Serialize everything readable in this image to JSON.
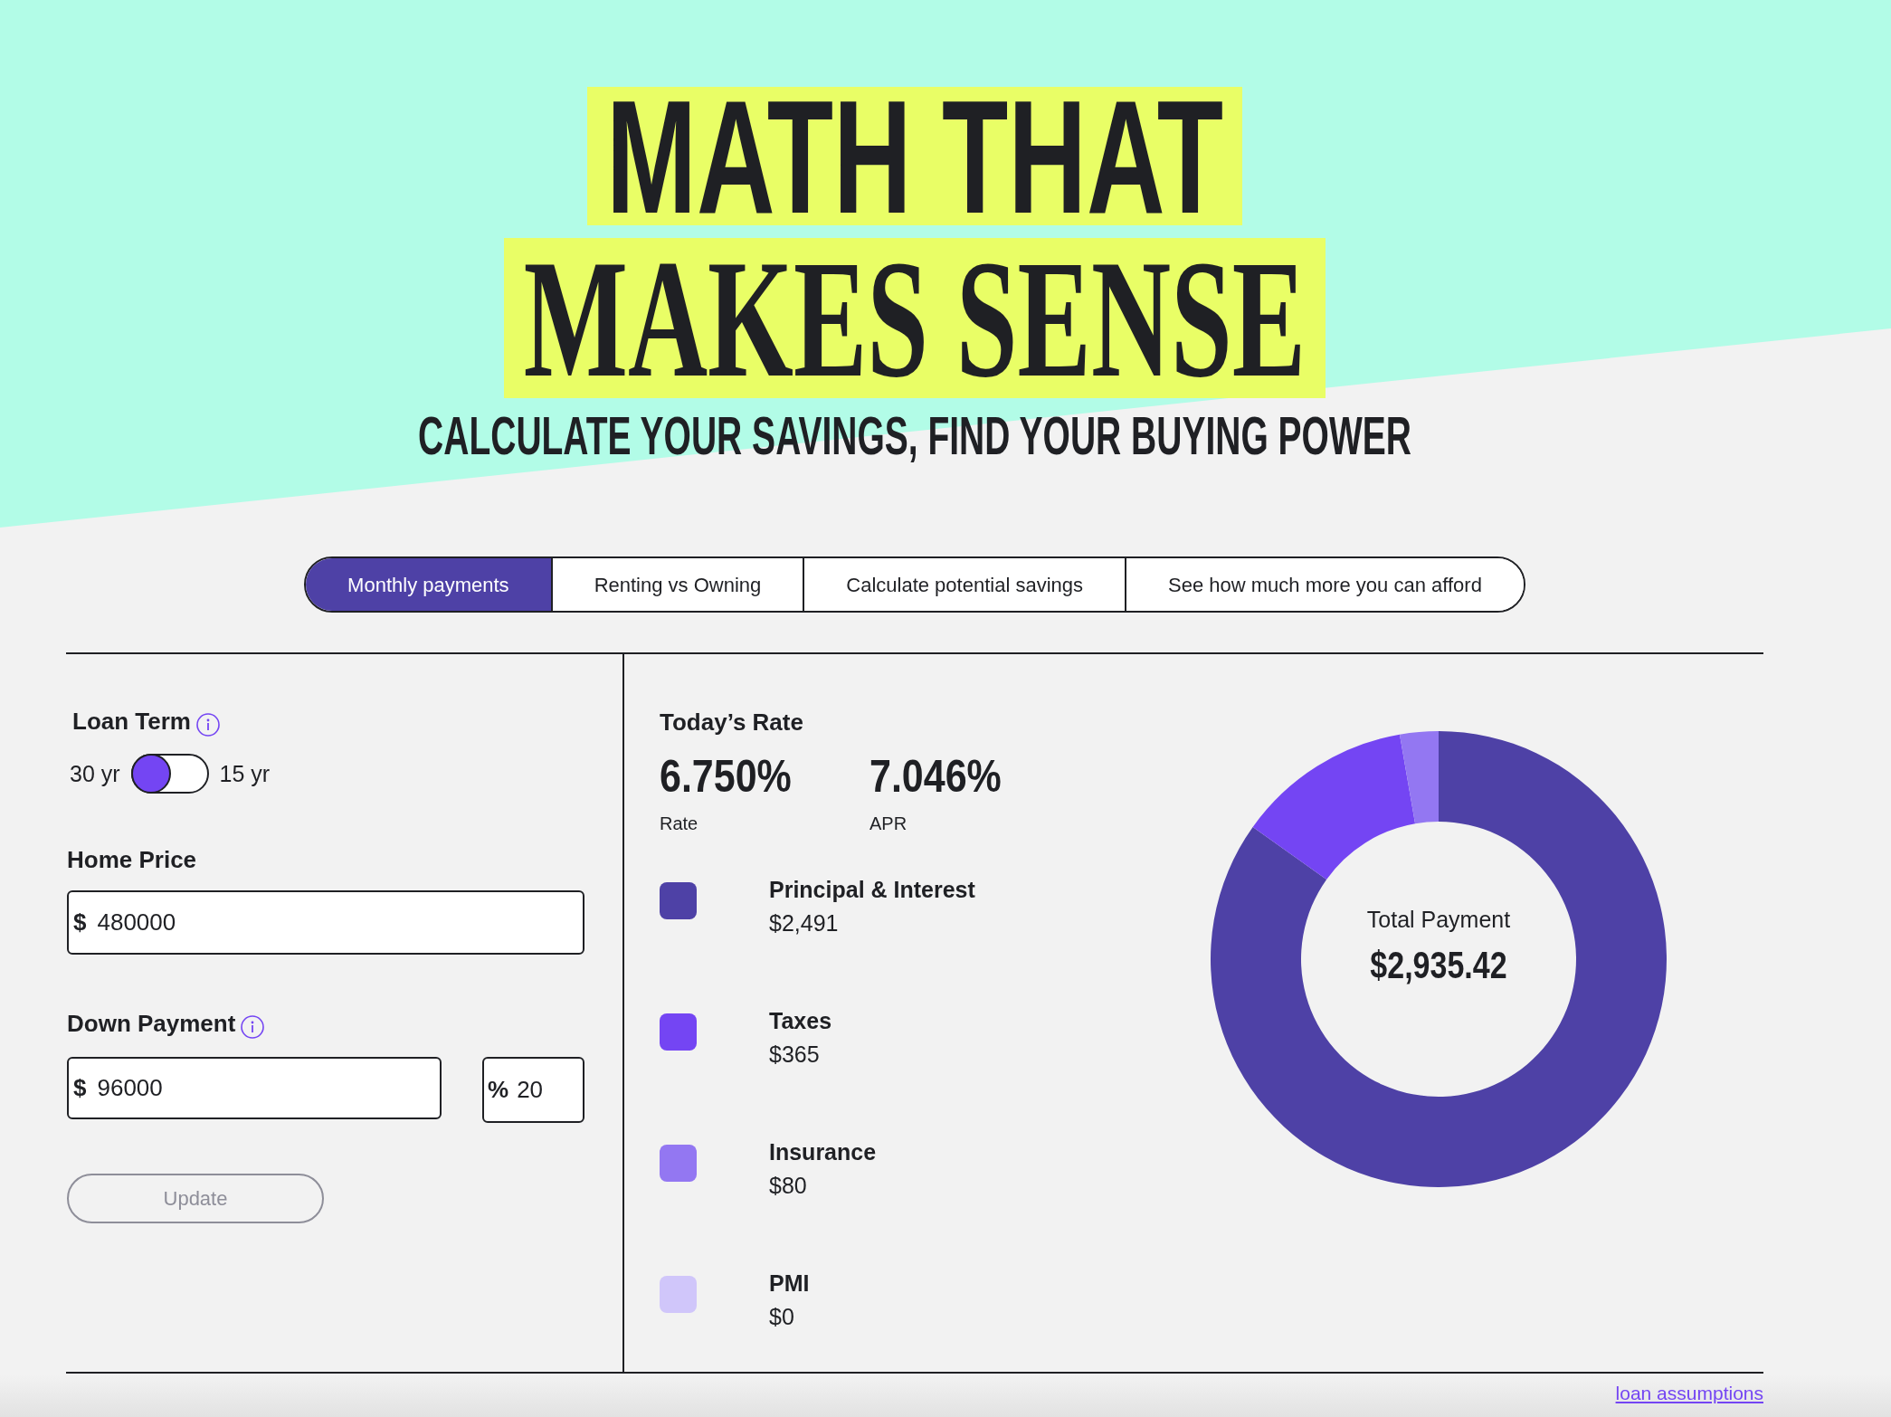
{
  "hero": {
    "headline": [
      {
        "text": "MATH THAT",
        "kind": "sans"
      },
      {
        "text": "MAKES SENSE",
        "kind": "serif"
      }
    ],
    "subheadline": "CALCULATE YOUR SAVINGS, FIND YOUR BUYING POWER"
  },
  "tabs": [
    {
      "label": "Monthly payments",
      "selected": true
    },
    {
      "label": "Renting vs Owning",
      "selected": false
    },
    {
      "label": "Calculate potential savings",
      "selected": false
    },
    {
      "label": "See how much more you can afford",
      "selected": false
    }
  ],
  "form": {
    "loan_term": {
      "label": "Loan Term",
      "options": [
        "30 yr",
        "15 yr"
      ],
      "on": false
    },
    "home_price": {
      "label": "Home Price",
      "prefix": "$",
      "value": "480000"
    },
    "down_payment": {
      "label": "Down Payment",
      "amount": {
        "prefix": "$",
        "value": "96000"
      },
      "percent": {
        "prefix": "%",
        "value": "20"
      }
    },
    "update_button": {
      "label": "Update",
      "disabled": true
    }
  },
  "rates": {
    "title": "Today’s Rate",
    "items": [
      {
        "value": "6.750%",
        "label": "Rate"
      },
      {
        "value": "7.046%",
        "label": "APR"
      }
    ]
  },
  "breakdown": {
    "chart_data": {
      "type": "donut",
      "categories": [
        "Principal & Interest",
        "Taxes",
        "Insurance",
        "PMI"
      ],
      "values": [
        84.84,
        12.43,
        2.73,
        0
      ],
      "colors": [
        "#4e41a6",
        "#7445f3",
        "#9377f2",
        "#d0c6fa"
      ]
    },
    "legend_amounts": [
      "$2,491",
      "$365",
      "$80",
      "$0"
    ],
    "center_label": "Total Payment",
    "center_value": "$2,935.42"
  },
  "footer": {
    "link": "loan assumptions"
  }
}
